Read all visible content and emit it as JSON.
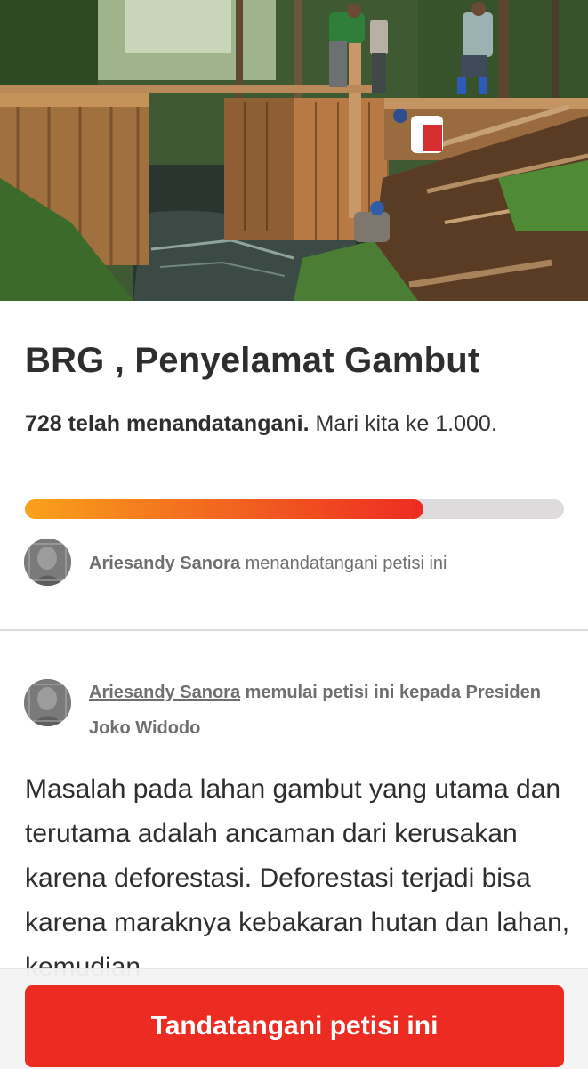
{
  "petition": {
    "title": "BRG , Penyelamat Gambut",
    "signature_count_text": "728 telah menandatangani.",
    "goal_text": "Mari kita ke 1.000.",
    "progress_fraction": 0.74
  },
  "recent_signer": {
    "name": "Ariesandy Sanora",
    "action_text": "menandatangani petisi ini"
  },
  "starter": {
    "name": "Ariesandy Sanora",
    "action_text": "memulai petisi ini kepada Presiden Joko Widodo"
  },
  "body_text": "Masalah pada lahan gambut yang utama dan terutama adalah ancaman dari kerusakan karena deforestasi. Deforestasi terjadi bisa karena maraknya kebakaran hutan dan lahan, kemudian",
  "cta": {
    "sign_label": "Tandatangani petisi ini"
  },
  "colors": {
    "accent_red": "#ec2c22",
    "progress_start": "#f9a11b",
    "progress_track": "#dddbdc"
  },
  "icons": {
    "signer_avatar": "profile-photo-avatar",
    "starter_avatar": "profile-photo-avatar"
  }
}
